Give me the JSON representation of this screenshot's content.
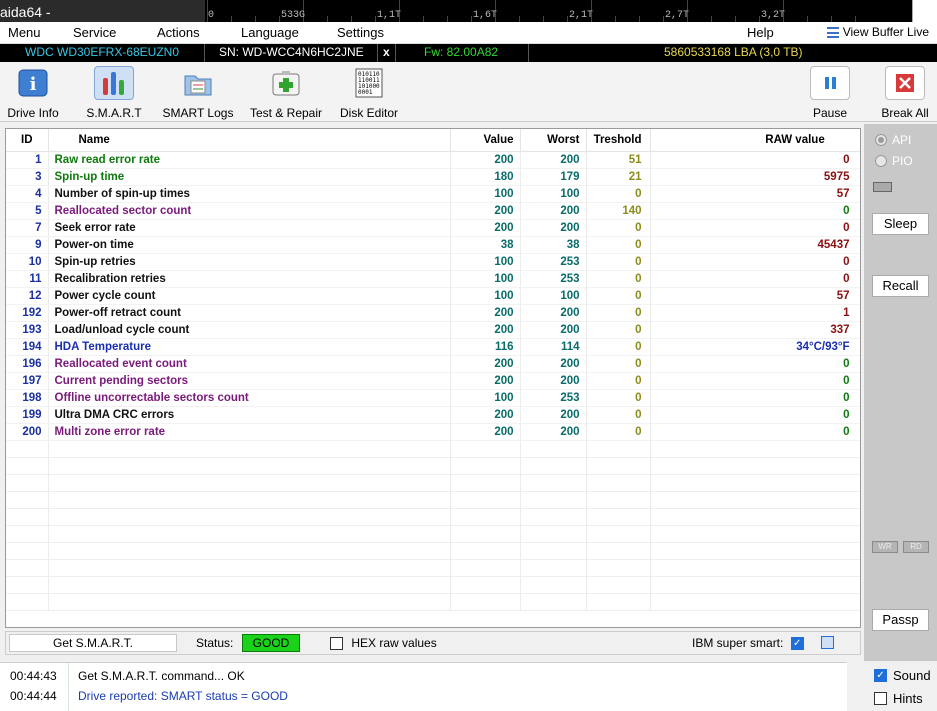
{
  "window": {
    "title": "aida64 -"
  },
  "ruler": {
    "labels": [
      "0",
      "533G",
      "1,1T",
      "1,6T",
      "2,1T",
      "2,7T",
      "3,2T"
    ]
  },
  "menu": {
    "items": [
      "Menu",
      "Service",
      "Actions",
      "Language",
      "Settings",
      "Help"
    ],
    "view_buffer": "View Buffer Live"
  },
  "drive": {
    "model": "WDC WD30EFRX-68EUZN0",
    "serial": "SN: WD-WCC4N6HC2JNE",
    "close": "x",
    "firmware": "Fw: 82.00A82",
    "lba": "5860533168 LBA (3,0 TB)",
    "colors": {
      "model": "#36c6e6",
      "serial": "#ffffff",
      "firmware": "#33d633",
      "lba": "#e8d84a"
    }
  },
  "toolbar": {
    "buttons": [
      {
        "label": "Drive Info",
        "icon": "info-icon"
      },
      {
        "label": "S.M.A.R.T",
        "icon": "smart-bars-icon",
        "active": true
      },
      {
        "label": "SMART Logs",
        "icon": "folder-log-icon"
      },
      {
        "label": "Test & Repair",
        "icon": "first-aid-icon"
      },
      {
        "label": "Disk Editor",
        "icon": "binary-editor-icon"
      },
      {
        "label": "Pause",
        "icon": "pause-icon"
      },
      {
        "label": "Break All",
        "icon": "close-red-icon"
      }
    ]
  },
  "smart_table": {
    "headers": {
      "id": "ID",
      "name": "Name",
      "value": "Value",
      "worst": "Worst",
      "threshold": "Treshold",
      "raw": "RAW value"
    },
    "rows": [
      {
        "id": "1",
        "name": "Raw read error rate",
        "value": "200",
        "worst": "200",
        "threshold": "51",
        "raw": "0",
        "color": "#0f7a0f",
        "thr_color": "#8c8c1a",
        "raw_color": "#8a1010"
      },
      {
        "id": "3",
        "name": "Spin-up time",
        "value": "180",
        "worst": "179",
        "threshold": "21",
        "raw": "5975",
        "color": "#0f7a0f",
        "thr_color": "#8c8c1a",
        "raw_color": "#8a1010"
      },
      {
        "id": "4",
        "name": "Number of spin-up times",
        "value": "100",
        "worst": "100",
        "threshold": "0",
        "raw": "57",
        "color": "#111111",
        "thr_color": "#8c8c1a",
        "raw_color": "#8a1010"
      },
      {
        "id": "5",
        "name": "Reallocated sector count",
        "value": "200",
        "worst": "200",
        "threshold": "140",
        "raw": "0",
        "color": "#7a1a7a",
        "thr_color": "#8c8c1a",
        "raw_color": "#0f7a0f"
      },
      {
        "id": "7",
        "name": "Seek error rate",
        "value": "200",
        "worst": "200",
        "threshold": "0",
        "raw": "0",
        "color": "#111111",
        "thr_color": "#8c8c1a",
        "raw_color": "#8a1010"
      },
      {
        "id": "9",
        "name": "Power-on time",
        "value": "38",
        "worst": "38",
        "threshold": "0",
        "raw": "45437",
        "color": "#111111",
        "thr_color": "#8c8c1a",
        "raw_color": "#8a1010"
      },
      {
        "id": "10",
        "name": "Spin-up retries",
        "value": "100",
        "worst": "253",
        "threshold": "0",
        "raw": "0",
        "color": "#111111",
        "thr_color": "#8c8c1a",
        "raw_color": "#8a1010"
      },
      {
        "id": "11",
        "name": "Recalibration retries",
        "value": "100",
        "worst": "253",
        "threshold": "0",
        "raw": "0",
        "color": "#111111",
        "thr_color": "#8c8c1a",
        "raw_color": "#8a1010"
      },
      {
        "id": "12",
        "name": "Power cycle count",
        "value": "100",
        "worst": "100",
        "threshold": "0",
        "raw": "57",
        "color": "#111111",
        "thr_color": "#8c8c1a",
        "raw_color": "#8a1010"
      },
      {
        "id": "192",
        "name": "Power-off retract count",
        "value": "200",
        "worst": "200",
        "threshold": "0",
        "raw": "1",
        "color": "#111111",
        "thr_color": "#8c8c1a",
        "raw_color": "#8a1010"
      },
      {
        "id": "193",
        "name": "Load/unload cycle count",
        "value": "200",
        "worst": "200",
        "threshold": "0",
        "raw": "337",
        "color": "#111111",
        "thr_color": "#8c8c1a",
        "raw_color": "#8a1010"
      },
      {
        "id": "194",
        "name": "HDA Temperature",
        "value": "116",
        "worst": "114",
        "threshold": "0",
        "raw": "34°C/93°F",
        "color": "#1a2fb0",
        "thr_color": "#8c8c1a",
        "raw_color": "#1a2fb0"
      },
      {
        "id": "196",
        "name": "Reallocated event count",
        "value": "200",
        "worst": "200",
        "threshold": "0",
        "raw": "0",
        "color": "#7a1a7a",
        "thr_color": "#8c8c1a",
        "raw_color": "#0f7a0f"
      },
      {
        "id": "197",
        "name": "Current pending sectors",
        "value": "200",
        "worst": "200",
        "threshold": "0",
        "raw": "0",
        "color": "#7a1a7a",
        "thr_color": "#8c8c1a",
        "raw_color": "#0f7a0f"
      },
      {
        "id": "198",
        "name": "Offline uncorrectable sectors count",
        "value": "100",
        "worst": "253",
        "threshold": "0",
        "raw": "0",
        "color": "#7a1a7a",
        "thr_color": "#8c8c1a",
        "raw_color": "#0f7a0f"
      },
      {
        "id": "199",
        "name": "Ultra DMA CRC errors",
        "value": "200",
        "worst": "200",
        "threshold": "0",
        "raw": "0",
        "color": "#111111",
        "thr_color": "#8c8c1a",
        "raw_color": "#0f7a0f"
      },
      {
        "id": "200",
        "name": "Multi zone error rate",
        "value": "200",
        "worst": "200",
        "threshold": "0",
        "raw": "0",
        "color": "#7a1a7a",
        "thr_color": "#8c8c1a",
        "raw_color": "#0f7a0f"
      }
    ]
  },
  "status": {
    "get_smart": "Get S.M.A.R.T.",
    "status_label": "Status:",
    "status_value": "GOOD",
    "hex_label": "HEX raw values",
    "hex_checked": false,
    "ibm_label": "IBM super smart:",
    "ibm_checked": true
  },
  "log": [
    {
      "time": "00:44:43",
      "message": "Get S.M.A.R.T. command... OK",
      "color": "#000000"
    },
    {
      "time": "00:44:44",
      "message": "Drive reported: SMART status = GOOD",
      "color": "#1a3cb0"
    }
  ],
  "right_panel": {
    "api_label": "API",
    "pio_label": "PIO",
    "sleep": "Sleep",
    "recall": "Recall",
    "wr": "WR",
    "rd": "RD",
    "passp": "Passp",
    "sound_label": "Sound",
    "sound_checked": true,
    "hints_label": "Hints",
    "hints_checked": false
  }
}
